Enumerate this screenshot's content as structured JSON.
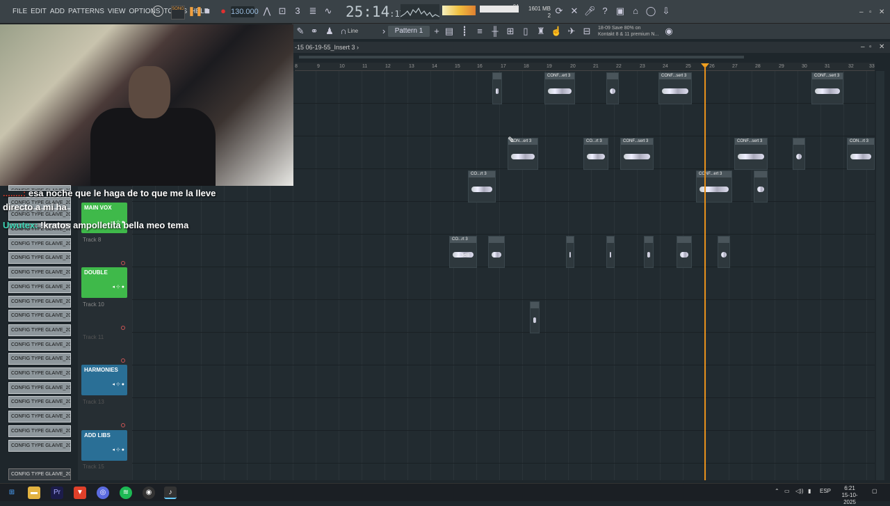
{
  "menu": [
    "FILE",
    "EDIT",
    "ADD",
    "PATTERNS",
    "VIEW",
    "OPTIONS",
    "TOOLS",
    "HELP"
  ],
  "song_label": "SONG",
  "tempo": "130.000",
  "time": {
    "main": "25:14",
    "sub": "17"
  },
  "memory": {
    "mb": "1601 MB",
    "cores": "2"
  },
  "meter_value": "84",
  "toolbar2": {
    "snap": "Line",
    "pattern": "Pattern 1"
  },
  "hint": {
    "line1": "18-09  Save 80% on",
    "line2": "Kontakt 8 & 11 premium N..."
  },
  "playlist_title": "-15 06-19-55_Insert 3 ›",
  "ruler": [
    "8",
    "9",
    "10",
    "11",
    "12",
    "13",
    "14",
    "15",
    "16",
    "17",
    "18",
    "19",
    "20",
    "21",
    "22",
    "23",
    "24",
    "25",
    "26",
    "27",
    "28",
    "29",
    "30",
    "31",
    "32",
    "33"
  ],
  "chat": [
    {
      "user": "........:",
      "text": " esa noche que le haga de to que me la lleve"
    },
    {
      "user": "",
      "text": "directo a mi ha"
    },
    {
      "user": "Uwutex:",
      "text": " !kratos ampolletita bella meo tema"
    }
  ],
  "pattern_list": [
    "CONFIG TYPE GLAIVE_202...",
    "CONFIG TYPE GLAIVE_202...",
    "CONFIG TYPE GLAIVE_202...",
    "CONFIG TYPE GLAIVE_202...",
    "CONFIG TYPE GLAIVE_202...",
    "CONFIG TYPE GLAIVE_202...",
    "CONFIG TYPE GLAIVE_202...",
    "CONFIG TYPE GLAIVE_202...",
    "CONFIG TYPE GLAIVE_202...",
    "CONFIG TYPE GLAIVE_202...",
    "CONFIG TYPE GLAIVE_202...",
    "CONFIG TYPE GLAIVE_202...",
    "CONFIG TYPE GLAIVE_202...",
    "CONFIG TYPE GLAIVE_202...",
    "CONFIG TYPE GLAIVE_202...",
    "CONFIG TYPE GLAIVE_202...",
    "CONFIG TYPE GLAIVE_202...",
    "CONFIG TYPE GLAIVE_202...",
    "CONFIG TYPE GLAIVE_202...",
    "CONFIG TYPE GLAIVE_202..."
  ],
  "tracks": [
    {
      "name": "MAIN VOX",
      "color": "#3fb94a"
    },
    {
      "label": "Track 8"
    },
    {
      "name": "DOUBLE",
      "color": "#3fb94a"
    },
    {
      "label": "Track 10"
    },
    {
      "label": "Track 11"
    },
    {
      "name": "HARMONIES",
      "color": "#2a6f96"
    },
    {
      "label": "Track 13"
    },
    {
      "name": "ADD LIBS",
      "color": "#2a6f96"
    },
    {
      "label": "Track 15"
    }
  ],
  "clips": [
    {
      "label": "CONF...ert 3"
    },
    {
      "label": "CONF...sert 3"
    },
    {
      "label": "CONF...sert 3"
    },
    {
      "label": "CON...ert 3"
    },
    {
      "label": "CO...rt 3"
    },
    {
      "label": "CONF...sert 3"
    },
    {
      "label": "CONF...sert 3"
    },
    {
      "label": "CON...rt 3"
    },
    {
      "label": "CO...rt 3"
    },
    {
      "label": "CONF...ert 3"
    },
    {
      "label": "CO...rt 3"
    },
    {
      "label": "2.3dB"
    }
  ],
  "taskbar": {
    "lang": "ESP",
    "clock": "6:21",
    "date": "15-10-2025"
  }
}
